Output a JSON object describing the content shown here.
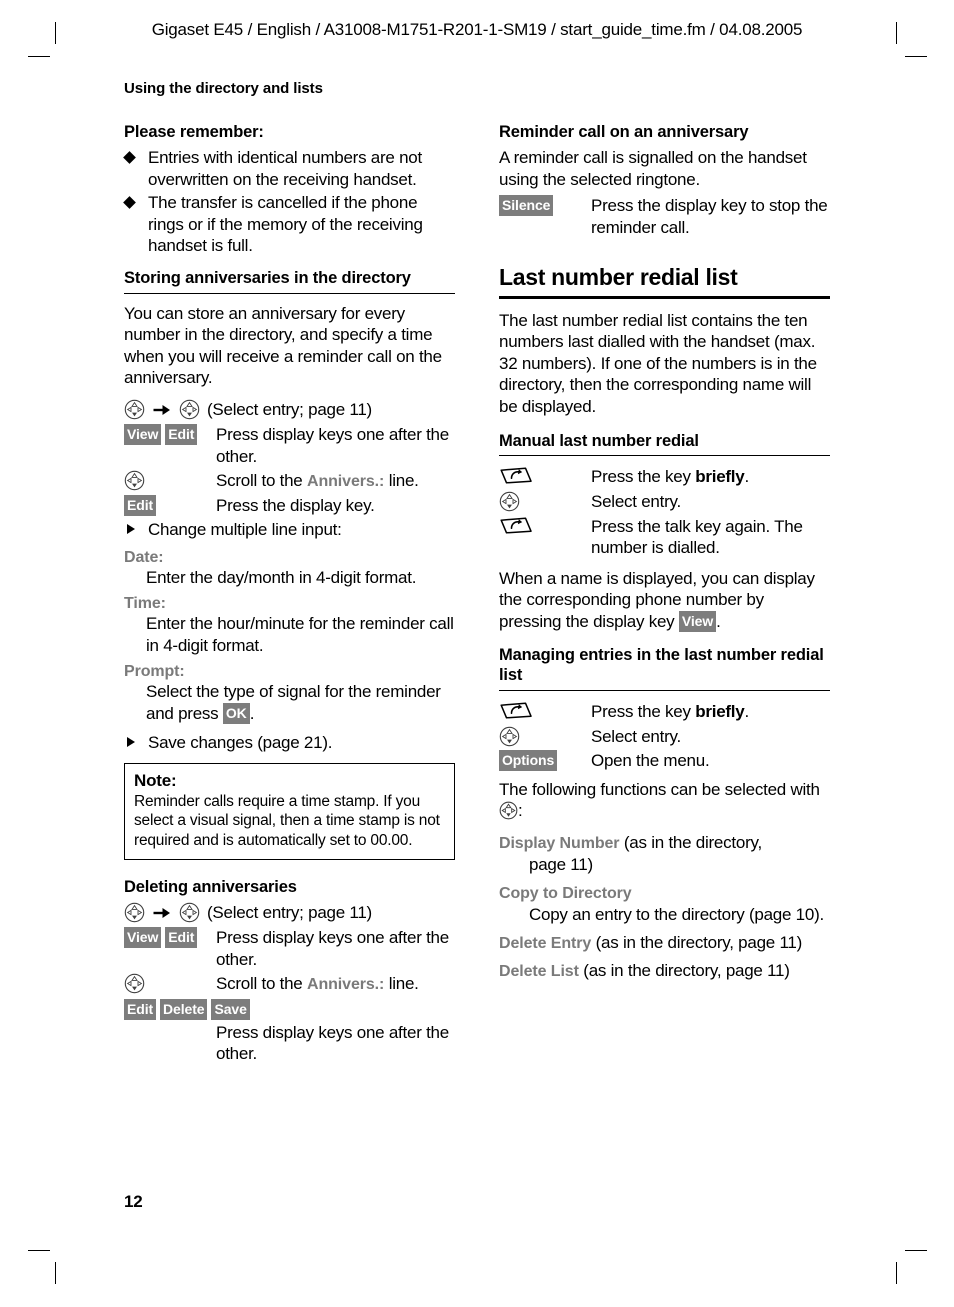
{
  "header": {
    "running_head": "Gigaset E45 / English / A31008-M1751-R201-1-SM19 / start_guide_time.fm / 04.08.2005"
  },
  "chapter_title": "Using the directory and lists",
  "footer": {
    "page_number": "12"
  },
  "left_column": {
    "please_remember": {
      "heading": "Please remember:",
      "bullets": [
        "Entries with identical numbers are not overwritten on the receiving handset.",
        "The transfer is cancelled if the phone rings or if the memory of the receiving handset is full."
      ]
    },
    "storing_anniversaries": {
      "heading": "Storing anniversaries in the directory",
      "intro": "You can store an anniversary for every number in the directory, and specify a time when you will receive a reminder call on the anniversary.",
      "nav_line": "(Select entry; page 11)",
      "steps": [
        {
          "keys": [
            "View",
            "Edit"
          ],
          "desc": "Press display keys one after the other."
        },
        {
          "icon": "nav-key-icon",
          "desc_pre": "Scroll to the ",
          "desc_gray": "Annivers.:",
          "desc_post": " line."
        },
        {
          "keys": [
            "Edit"
          ],
          "desc": "Press the display key."
        }
      ],
      "change_multiple": "Change multiple line input:",
      "fields": [
        {
          "name": "Date:",
          "text": "Enter the day/month in 4-digit format."
        },
        {
          "name": "Time:",
          "text": "Enter the hour/minute for the reminder call in 4-digit format."
        },
        {
          "name": "Prompt:",
          "text_pre": "Select the type of signal for the reminder and press ",
          "key": "OK",
          "text_post": "."
        }
      ],
      "save_changes": "Save changes (page 21).",
      "note": {
        "title": "Note:",
        "text": "Reminder calls require a time stamp. If you select a visual signal, then a time stamp is not required and is automatically set to 00.00."
      }
    },
    "deleting_anniversaries": {
      "heading": "Deleting anniversaries",
      "nav_line": "(Select entry; page 11)",
      "steps": [
        {
          "keys": [
            "View",
            "Edit"
          ],
          "desc": "Press display keys one after the other."
        },
        {
          "icon": "nav-key-icon",
          "desc_pre": "Scroll to the ",
          "desc_gray": "Annivers.:",
          "desc_post": " line."
        },
        {
          "keys": [
            "Edit",
            "Delete",
            "Save"
          ],
          "desc": "Press display keys one after the other."
        }
      ]
    }
  },
  "right_column": {
    "reminder_call": {
      "heading": "Reminder call on an anniversary",
      "intro": "A reminder call is signalled on the handset using the selected ringtone.",
      "step": {
        "key": "Silence",
        "desc": "Press the display key to stop the reminder call."
      }
    },
    "last_number_redial": {
      "heading": "Last number redial list",
      "intro": "The last number redial list contains the ten numbers last dialled with the handset (max. 32 numbers). If one of the numbers is in the directory, then the corresponding name will be displayed."
    },
    "manual_redial": {
      "heading": "Manual last number redial",
      "steps": [
        {
          "icon": "talk-key-icon",
          "desc_pre": "Press the key ",
          "desc_bold": "briefly",
          "desc_post": "."
        },
        {
          "icon": "nav-key-icon",
          "desc": "Select entry."
        },
        {
          "icon": "talk-key-icon",
          "desc": "Press the talk key again. The number is dialled."
        }
      ],
      "outro_pre": "When a name is displayed, you can display the corresponding phone number by pressing the display key ",
      "outro_key": "View",
      "outro_post": "."
    },
    "managing_entries": {
      "heading": "Managing entries in the last number redial list",
      "steps": [
        {
          "icon": "talk-key-icon",
          "desc_pre": "Press the key ",
          "desc_bold": "briefly",
          "desc_post": "."
        },
        {
          "icon": "nav-key-icon",
          "desc": "Select entry."
        },
        {
          "key": "Options",
          "desc": "Open the menu."
        }
      ],
      "functions_intro_pre": "The following functions can be selected with ",
      "functions_intro_post": ":",
      "functions": [
        {
          "name": "Display Number",
          "text": " (as in the directory,",
          "cont": "page 11)"
        },
        {
          "name": "Copy to Directory",
          "text": "",
          "cont": "Copy an entry to the directory (page 10)."
        },
        {
          "name": "Delete Entry",
          "text": " (as in the directory, page 11)",
          "cont": ""
        },
        {
          "name": "Delete List",
          "text": " (as in the directory, page 11)",
          "cont": ""
        }
      ]
    }
  },
  "colors": {
    "display_key_bg": "#7d7d7d",
    "display_key_fg": "#ffffff",
    "gray_menu_text": "#7a7a7a",
    "body_text": "#000000"
  }
}
